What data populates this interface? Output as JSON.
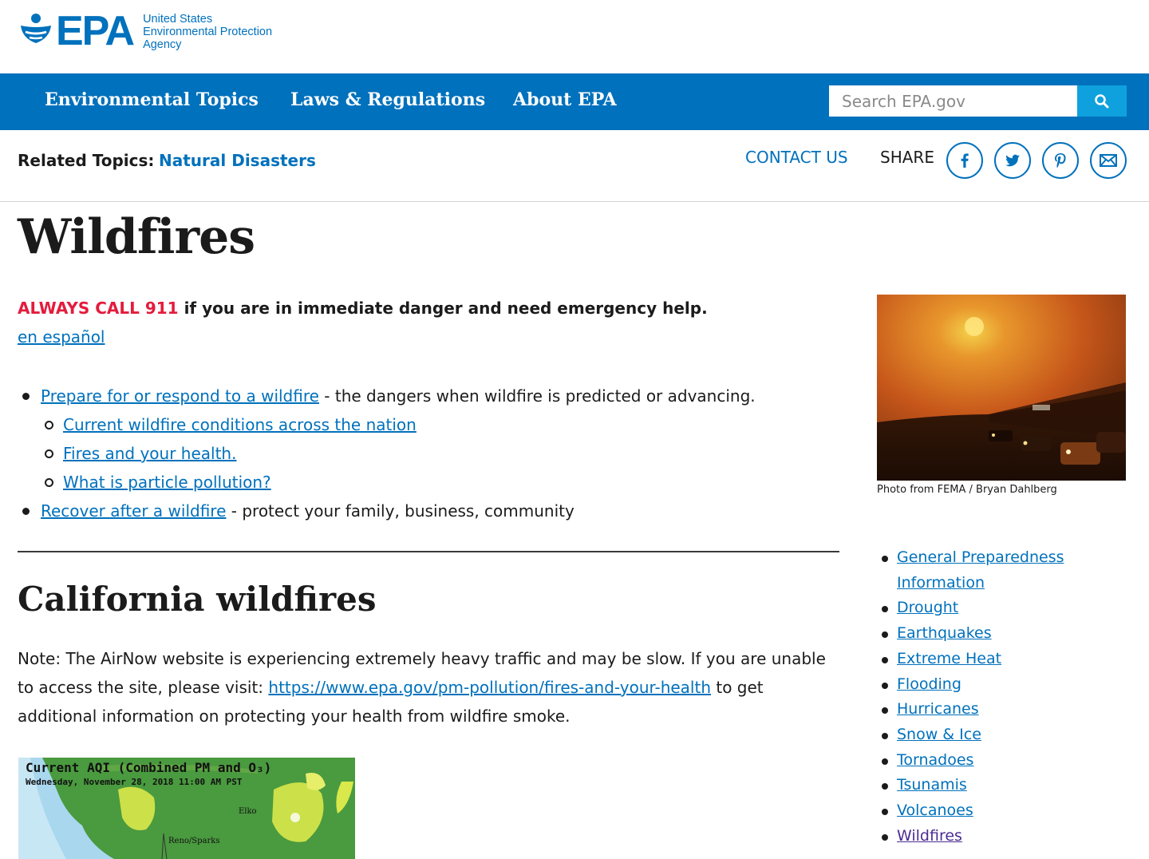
{
  "header": {
    "logo_text": "EPA",
    "agency_lines": [
      "United States",
      "Environmental Protection",
      "Agency"
    ]
  },
  "nav": {
    "items": [
      "Environmental Topics",
      "Laws & Regulations",
      "About EPA"
    ],
    "search_placeholder": "Search EPA.gov"
  },
  "related": {
    "label": "Related Topics:",
    "topic": "Natural Disasters",
    "contact": "CONTACT US",
    "share": "SHARE"
  },
  "main": {
    "title": "Wildfires",
    "alert_emphasis": "ALWAYS CALL 911",
    "alert_rest": " if you are in immediate danger and need emergency help.",
    "espanol": "en español",
    "bullets": [
      {
        "link": "Prepare for or respond to a wildfire",
        "text": " - the dangers when wildfire is predicted or advancing."
      },
      {
        "link": "Current wildfire conditions across the nation",
        "text": ""
      },
      {
        "link": "Fires and your health.",
        "text": ""
      },
      {
        "link": "What is particle pollution?",
        "text": ""
      },
      {
        "link": "Recover after a wildfire",
        "text": " - protect your family, business, community"
      }
    ],
    "section_title": "California wildfires",
    "note_before": "Note: The AirNow website is experiencing extremely heavy traffic and may be slow. If you are unable to access the site, please visit: ",
    "note_link": "https://www.epa.gov/pm-pollution/fires-and-your-health",
    "note_after": " to get additional information on protecting your health from wildfire smoke."
  },
  "aqi_map": {
    "title": "Current AQI (Combined PM and O₃)",
    "subtitle": "Wednesday, November 28, 2018 11:00 AM PST",
    "cities": [
      "Elko",
      "Reno/Sparks"
    ]
  },
  "sidebar": {
    "photo_caption": "Photo from FEMA / Bryan Dahlberg",
    "links": [
      "General Preparedness",
      "Information",
      "Drought",
      "Earthquakes",
      "Extreme Heat",
      "Flooding",
      "Hurricanes",
      "Snow & Ice",
      "Tornadoes",
      "Tsunamis",
      "Volcanoes",
      "Wildfires"
    ]
  },
  "colors": {
    "brand_blue": "#0071bc",
    "search_button": "#0fa1de",
    "alert_red": "#e31c3d",
    "visited_link": "#4c2c92"
  }
}
